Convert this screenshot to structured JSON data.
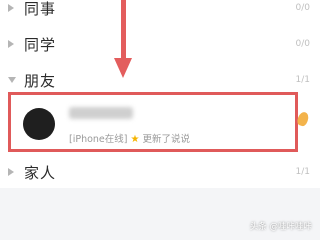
{
  "groups": [
    {
      "name": "同事",
      "count": "0/0",
      "expanded": false
    },
    {
      "name": "同学",
      "count": "0/0",
      "expanded": false
    },
    {
      "name": "朋友",
      "count": "1/1",
      "expanded": true
    },
    {
      "name": "家人",
      "count": "1/1",
      "expanded": false
    }
  ],
  "contact": {
    "status_prefix": "[iPhone在线]",
    "status_icon": "star-icon",
    "status_text": "更新了说说"
  },
  "watermark": "头条 @哇咔哇咔",
  "colors": {
    "highlight_border": "#e05a5a",
    "arrow": "#e35d5d",
    "star": "#f5b400"
  }
}
